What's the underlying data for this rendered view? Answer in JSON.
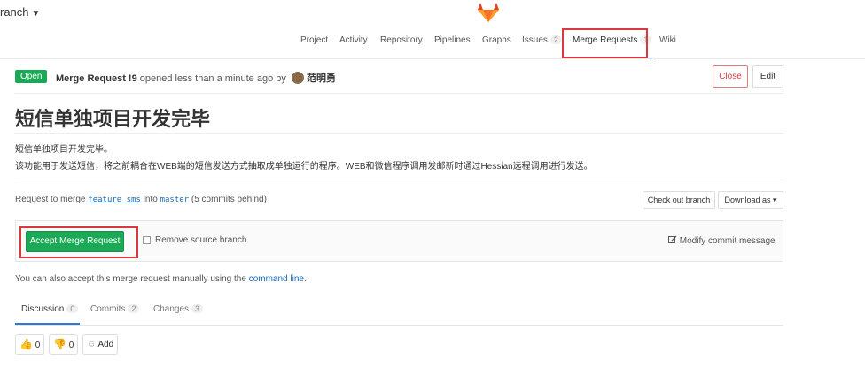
{
  "header": {
    "branch_label": "ranch",
    "nav": [
      {
        "label": "Project"
      },
      {
        "label": "Activity"
      },
      {
        "label": "Repository"
      },
      {
        "label": "Pipelines"
      },
      {
        "label": "Graphs"
      },
      {
        "label": "Issues",
        "count": "2"
      },
      {
        "label": "Merge Requests",
        "count": "1"
      },
      {
        "label": "Wiki"
      }
    ]
  },
  "mr": {
    "state": "Open",
    "title_ref": "Merge Request !9",
    "opened_text": "opened less than a minute ago by",
    "author": "范明勇",
    "close_label": "Close",
    "edit_label": "Edit",
    "title": "短信单独项目开发完毕",
    "description": [
      "短信单独项目开发完毕。",
      "该功能用于发送短信，将之前耦合在WEB端的短信发送方式抽取成单独运行的程序。WEB和微信程序调用发邮新时通过Hessian远程调用进行发送。"
    ],
    "request_prefix": "Request to merge",
    "source_branch": "feature_sms",
    "into": "into",
    "target_branch": "master",
    "behind": "(5 commits behind)",
    "checkout_label": "Check out branch",
    "download_label": "Download as",
    "accept_label": "Accept Merge Request",
    "remove_source_label": "Remove source branch",
    "modify_commit_label": "Modify commit message",
    "manual_prefix": "You can also accept this merge request manually using the",
    "command_line": "command line",
    "manual_suffix": "."
  },
  "tabs": [
    {
      "label": "Discussion",
      "count": "0"
    },
    {
      "label": "Commits",
      "count": "2"
    },
    {
      "label": "Changes",
      "count": "3"
    }
  ],
  "awards": {
    "thumbs_up": "0",
    "thumbs_down": "0",
    "add_label": "Add"
  },
  "colors": {
    "accent_green": "#1aaa55",
    "highlight_red": "#d9383f",
    "link_blue": "#1b69b6"
  }
}
